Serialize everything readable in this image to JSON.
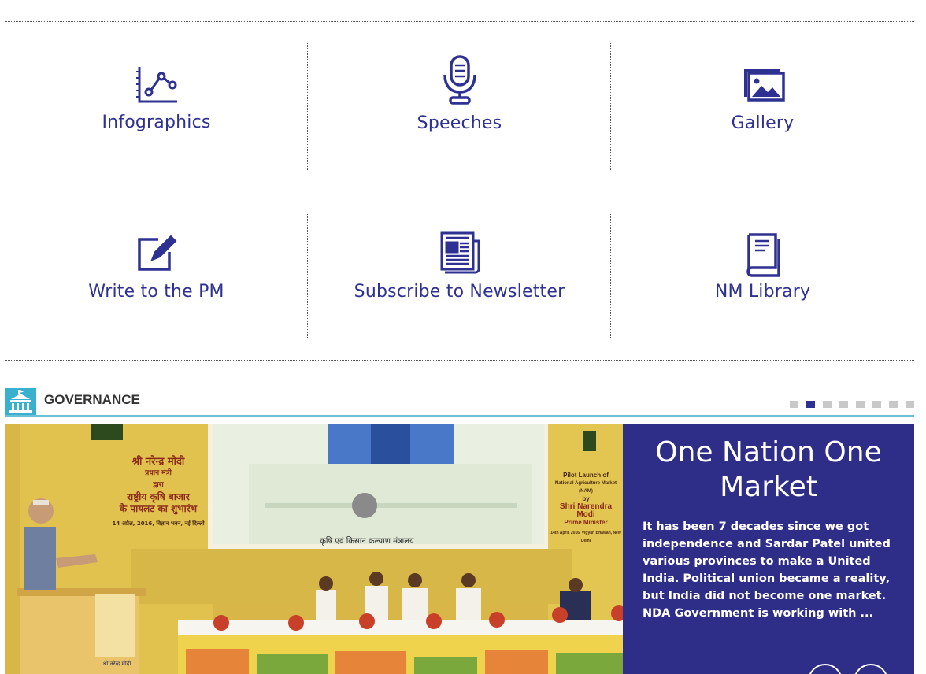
{
  "tiles": [
    {
      "label": "Infographics",
      "icon": "infographics-chart-icon"
    },
    {
      "label": "Speeches",
      "icon": "microphone-icon"
    },
    {
      "label": "Gallery",
      "icon": "gallery-image-icon"
    },
    {
      "label": "Write to the PM",
      "icon": "write-pencil-icon"
    },
    {
      "label": "Subscribe to Newsletter",
      "icon": "newspaper-icon"
    },
    {
      "label": "NM Library",
      "icon": "book-icon"
    }
  ],
  "governance": {
    "title": "GOVERNANCE",
    "slide_count": 8,
    "active_slide": 2
  },
  "slide": {
    "title": "One Nation One Market",
    "text": "It has been 7 decades since we got independence and Sardar Patel united various provinces to make a United India. Political union became a reality, but India did not become one market. NDA Government is working with ...",
    "photo": {
      "banner_left_lines": [
        "श्री नरेन्द्र मोदी",
        "प्रधान मंत्री",
        "द्वारा",
        "राष्ट्रीय कृषि बाजार",
        "के पायलट का शुभारंभ"
      ],
      "banner_left_date": "14 अप्रैल, 2016, विज्ञान भवन, नई दिल्ली",
      "banner_right_lines": [
        "Pilot Launch of",
        "National Agriculture Market (NAM)",
        "by",
        "Shri Narendra Modi",
        "Prime Minister"
      ],
      "banner_right_date": "14th April, 2016, Vigyan Bhawan, New Delhi",
      "screen_caption": "कृषि एवं किसान कल्याण मंत्रालय",
      "podium_text": "श्री नरेन्द्र मोदी"
    }
  },
  "colors": {
    "accent": "#2e3192",
    "panel": "#2e2d87",
    "governance_bar": "#3ab0cf",
    "dot_inactive": "#c8c8c8"
  }
}
